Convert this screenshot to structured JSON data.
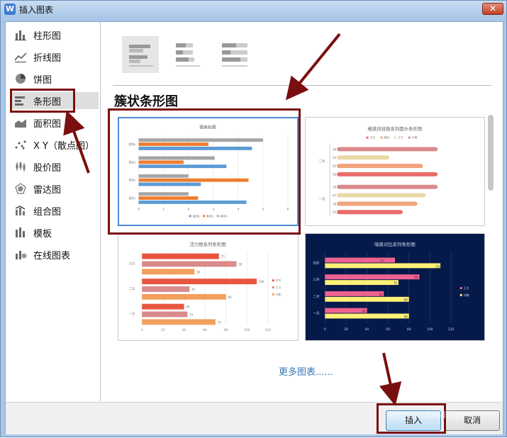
{
  "window": {
    "title": "插入图表",
    "app_icon_text": "W"
  },
  "sidebar": {
    "items": [
      {
        "label": "柱形图",
        "icon": "column-chart-icon"
      },
      {
        "label": "折线图",
        "icon": "line-chart-icon"
      },
      {
        "label": "饼图",
        "icon": "pie-chart-icon"
      },
      {
        "label": "条形图",
        "icon": "bar-chart-icon"
      },
      {
        "label": "面积图",
        "icon": "area-chart-icon"
      },
      {
        "label": "X Y（散点图）",
        "icon": "scatter-chart-icon"
      },
      {
        "label": "股价图",
        "icon": "stock-chart-icon"
      },
      {
        "label": "雷达图",
        "icon": "radar-chart-icon"
      },
      {
        "label": "组合图",
        "icon": "combo-chart-icon"
      },
      {
        "label": "模板",
        "icon": "template-icon"
      },
      {
        "label": "在线图表",
        "icon": "online-chart-icon"
      }
    ],
    "selected": "条形图"
  },
  "section_title": "簇状条形图",
  "templates": {
    "card1": {
      "title": "图表标题",
      "categories": [
        "类别4",
        "类别3",
        "类别2",
        "类别1"
      ],
      "x_ticks": [
        "0",
        "1",
        "2",
        "3",
        "4",
        "5",
        "6"
      ],
      "legend": [
        "系列1",
        "系列2",
        "系列3"
      ]
    },
    "card2": {
      "title": "橘黄风轻微系列圆头条形图",
      "legend": [
        "文东",
        "章韵",
        "王方",
        "刘畅"
      ],
      "groups": [
        "二月",
        "一月"
      ],
      "values": [
        "98",
        "54",
        "85",
        "59",
        "58",
        "67",
        "78",
        "65"
      ]
    },
    "card3": {
      "title": "活力橙系列条形图",
      "groups": [
        "三日",
        "二日",
        "一日"
      ],
      "values": [
        "73",
        "90",
        "50",
        "109",
        "45",
        "80",
        "40",
        "43",
        "70"
      ],
      "legend": [
        "李华",
        "王方",
        "刘刚"
      ],
      "x_ticks": [
        "0",
        "20",
        "40",
        "60",
        "80",
        "100",
        "120"
      ]
    },
    "card4": {
      "title": "暗黄对比系列条形图",
      "groups": [
        "四月",
        "三月",
        "二月",
        "一月"
      ],
      "values": [
        "67",
        "110",
        "90",
        "70",
        "56",
        "80",
        "40",
        "80"
      ],
      "legend": [
        "王方",
        "刘畅"
      ],
      "x_ticks": [
        "0",
        "20",
        "40",
        "60",
        "80",
        "100",
        "120"
      ]
    }
  },
  "more_link": "更多图表......",
  "footer": {
    "insert_label": "插入",
    "cancel_label": "取消"
  },
  "watermark": "jingyan.baidu.com",
  "colors": {
    "accent_blue": "#4e8ad4",
    "annotation_red": "#7a0f0f"
  }
}
